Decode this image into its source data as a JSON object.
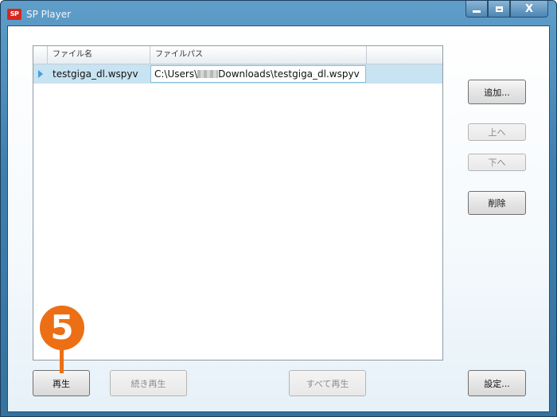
{
  "window": {
    "title": "SP Player",
    "icon_text": "SP",
    "controls": {
      "minimize": "",
      "maximize": "",
      "close": "X"
    }
  },
  "grid": {
    "columns": [
      "ファイル名",
      "ファイルパス",
      ""
    ],
    "rows": [
      {
        "name": "testgiga_dl.wspyv",
        "path_prefix": "C:\\Users\\",
        "path_suffix": "Downloads\\testgiga_dl.wspyv"
      }
    ]
  },
  "side_buttons": {
    "add": "追加...",
    "up": "上へ",
    "down": "下へ",
    "delete": "削除"
  },
  "bottom_buttons": {
    "play": "再生",
    "resume": "続き再生",
    "play_all": "すべて再生",
    "settings": "設定..."
  },
  "annotation": {
    "step": "5"
  },
  "colors": {
    "marker": "#ec6f15",
    "selected_row": "#c8e3f1"
  }
}
